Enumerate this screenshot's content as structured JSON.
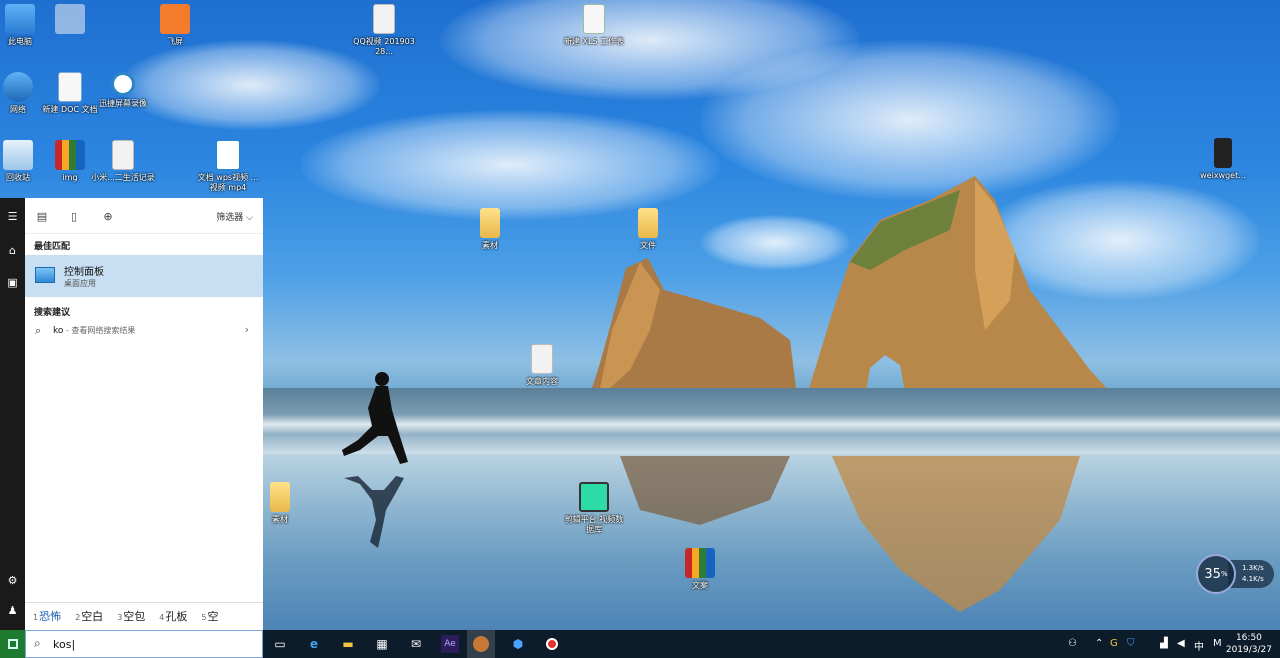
{
  "desktop": {
    "icons": [
      {
        "label": "此电脑"
      },
      {
        "label": ""
      },
      {
        "label": "飞屏"
      },
      {
        "label": "QQ视频 20190328..."
      },
      {
        "label": "新建 XLS 工作表"
      },
      {
        "label": "网络"
      },
      {
        "label": "新建 DOC 文档"
      },
      {
        "label": "迅捷屏幕录像"
      },
      {
        "label": "回收站"
      },
      {
        "label": "img"
      },
      {
        "label": "小米...二生活记录"
      },
      {
        "label": "文档 wps视频 ...视频 mp4"
      },
      {
        "label": "weixwget..."
      },
      {
        "label": "素材"
      },
      {
        "label": "文件"
      },
      {
        "label": "文章内容"
      },
      {
        "label": "素材"
      },
      {
        "label": "剪辑平台 视频数据库"
      },
      {
        "label": "文案"
      }
    ]
  },
  "start_panel": {
    "tab_filter_label": "筛选器",
    "best_match_heading": "最佳匹配",
    "best_match": {
      "title": "控制面板",
      "subtitle": "桌面应用"
    },
    "suggestions_heading": "搜索建议",
    "suggestion": {
      "query": "ko",
      "hint": " - 查看网络搜索结果"
    }
  },
  "ime": {
    "candidates": [
      {
        "num": "1",
        "text": "恐怖"
      },
      {
        "num": "2",
        "text": "空白"
      },
      {
        "num": "3",
        "text": "空包"
      },
      {
        "num": "4",
        "text": "孔板"
      },
      {
        "num": "5",
        "text": "空"
      }
    ]
  },
  "taskbar": {
    "search_value": "kos|",
    "clock_time": "16:50",
    "clock_date": "2019/3/27",
    "ime_indicator": "中",
    "ime_mode": "M"
  },
  "perf_widget": {
    "percent": "35",
    "unit": "%",
    "up": "1.3K/s",
    "down": "4.1K/s"
  },
  "colors": {
    "taskbar": "#0d1c2a",
    "selection": "#c8dff3",
    "start_green": "#1e7a2e"
  }
}
